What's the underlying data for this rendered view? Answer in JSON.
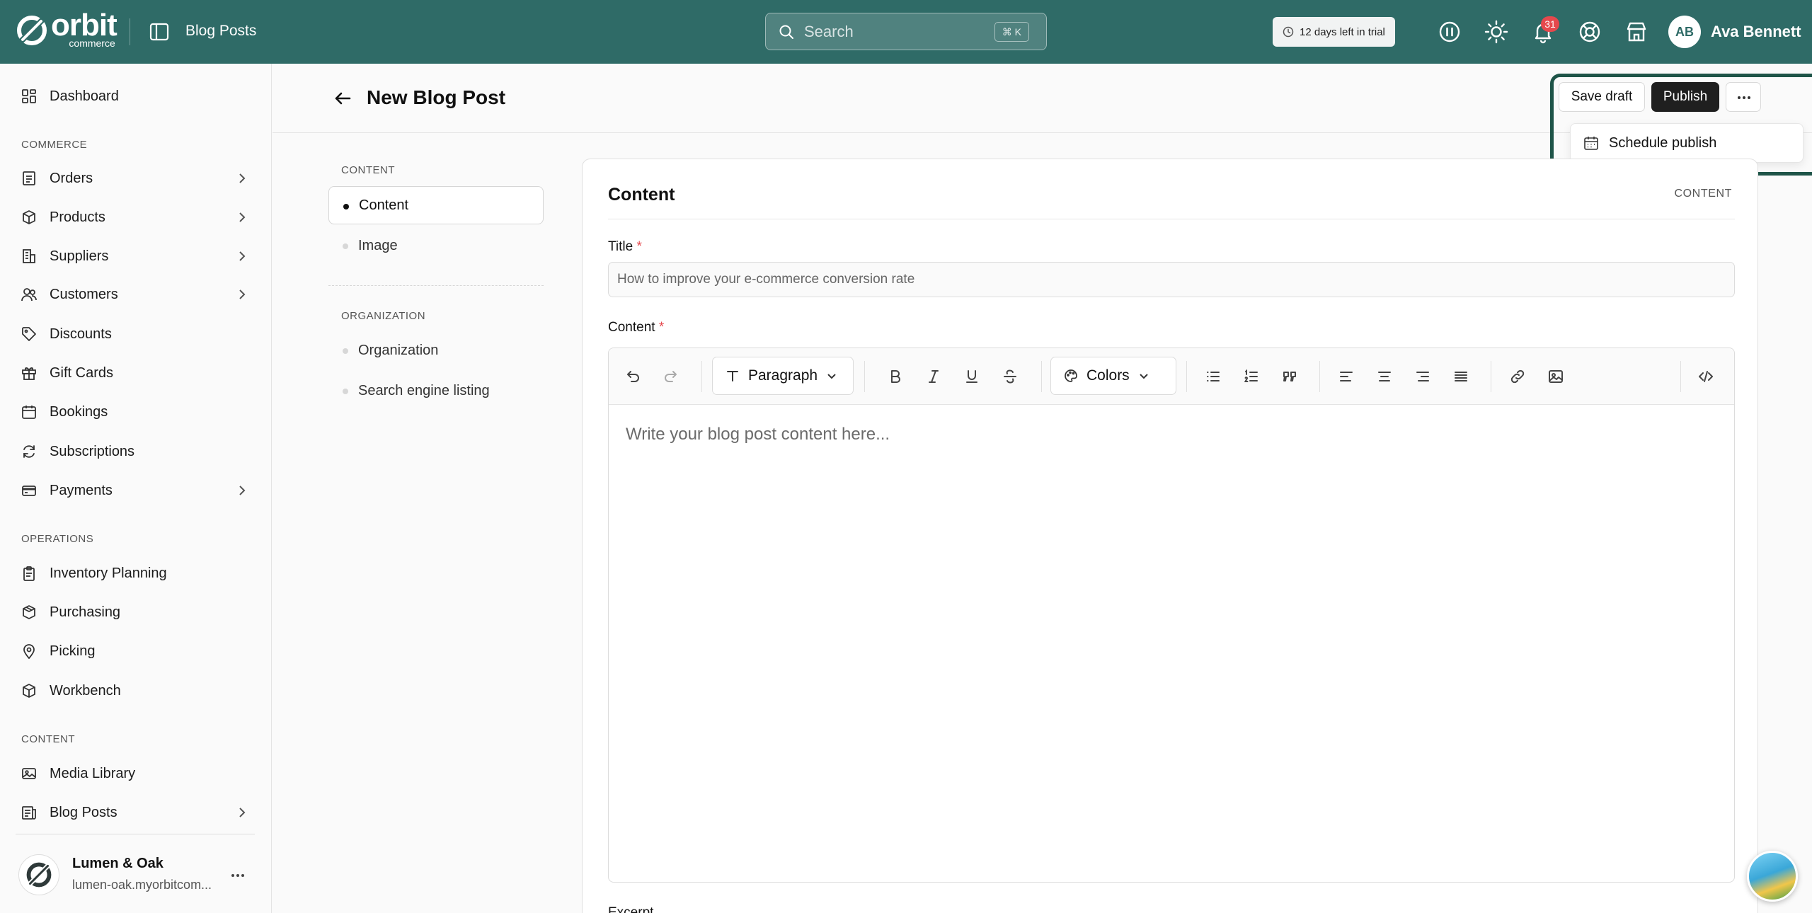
{
  "app": {
    "brand_word": "orbit",
    "brand_sub": "commerce",
    "breadcrumb": "Blog Posts"
  },
  "search": {
    "placeholder": "Search",
    "shortcut": "⌘ K"
  },
  "trial": {
    "text": "12 days left in trial"
  },
  "notifications": {
    "count": "31"
  },
  "user": {
    "initials": "AB",
    "name": "Ava Bennett"
  },
  "sidebar": {
    "items": [
      {
        "label": "Dashboard"
      },
      {
        "label": "Orders"
      },
      {
        "label": "Products"
      },
      {
        "label": "Suppliers"
      },
      {
        "label": "Customers"
      },
      {
        "label": "Discounts"
      },
      {
        "label": "Gift Cards"
      },
      {
        "label": "Bookings"
      },
      {
        "label": "Subscriptions"
      },
      {
        "label": "Payments"
      },
      {
        "label": "Inventory Planning"
      },
      {
        "label": "Purchasing"
      },
      {
        "label": "Picking"
      },
      {
        "label": "Workbench"
      },
      {
        "label": "Media Library"
      },
      {
        "label": "Blog Posts"
      }
    ],
    "sections": {
      "commerce": "COMMERCE",
      "operations": "OPERATIONS",
      "content": "CONTENT"
    },
    "store": {
      "name": "Lumen & Oak",
      "url": "lumen-oak.myorbitcom..."
    }
  },
  "page": {
    "title": "New Blog Post",
    "save_label": "Save draft",
    "publish_label": "Publish",
    "menu_item": "Schedule publish"
  },
  "section_nav": {
    "groups": [
      {
        "label": "CONTENT",
        "items": [
          "Content",
          "Image"
        ]
      },
      {
        "label": "ORGANIZATION",
        "items": [
          "Organization",
          "Search engine listing"
        ]
      }
    ]
  },
  "form": {
    "card_title": "Content",
    "card_tag": "CONTENT",
    "title_label": "Title",
    "title_placeholder": "How to improve your e-commerce conversion rate",
    "content_label": "Content",
    "required_mark": "*",
    "block_type": "Paragraph",
    "colors_label": "Colors",
    "editor_placeholder": "Write your blog post content here...",
    "excerpt_label": "Excerpt"
  },
  "colors": {
    "topbar": "#2f6b67",
    "primary_button": "#1f1f1f",
    "required": "#e5484d",
    "badge": "#e5484d"
  }
}
